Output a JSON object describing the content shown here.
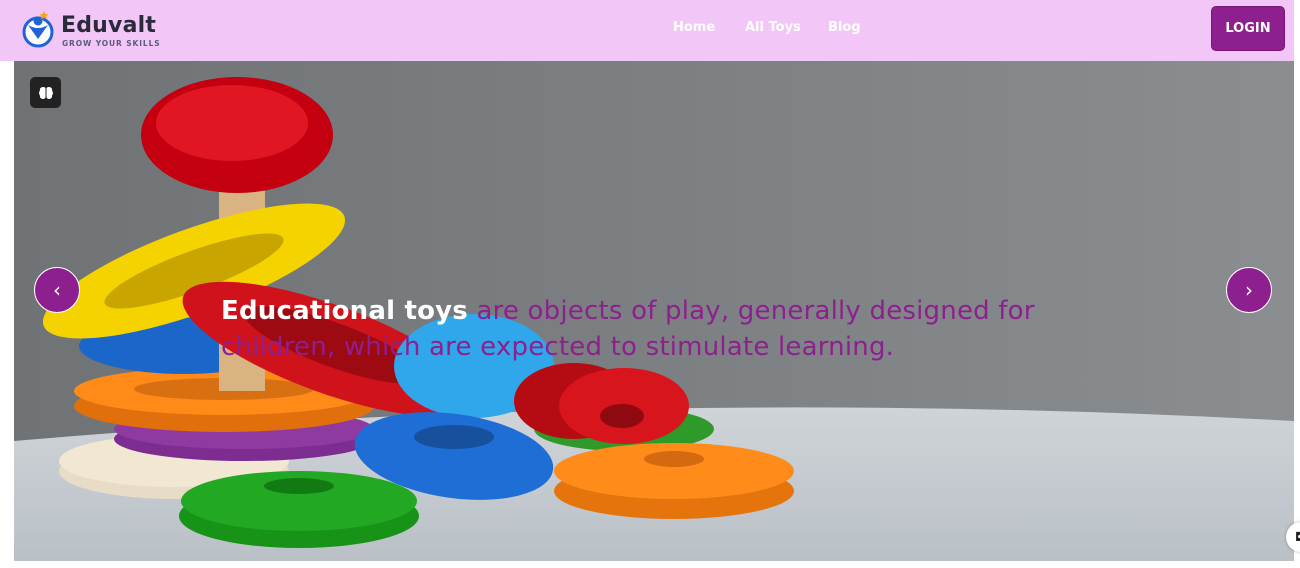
{
  "brand": {
    "name": "Eduvalt",
    "tagline": "GROW YOUR SKILLS",
    "icon": "graduate-person-icon"
  },
  "nav": {
    "links": [
      {
        "label": "Home"
      },
      {
        "label": "All Toys"
      },
      {
        "label": "Blog"
      }
    ],
    "login_label": "LOGIN"
  },
  "hero": {
    "highlight": "Educational toys",
    "body": " are objects of play, generally designed for children, which are expected to stimulate learning.",
    "prev_label": "‹",
    "next_label": "›",
    "brain_icon": "brain-icon"
  },
  "colors": {
    "navbar_bg": "#f2c6f6",
    "accent": "#8e1f8e",
    "hero_text_highlight": "#ffffff"
  }
}
